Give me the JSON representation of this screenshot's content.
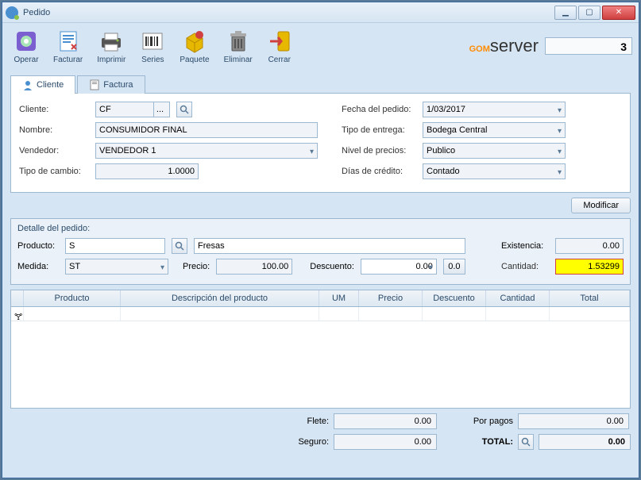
{
  "window": {
    "title": "Pedido"
  },
  "toolbar": {
    "operar": "Operar",
    "facturar": "Facturar",
    "imprimir": "Imprimir",
    "series": "Series",
    "paquete": "Paquete",
    "eliminar": "Eliminar",
    "cerrar": "Cerrar"
  },
  "brand": {
    "number": "3"
  },
  "tabs": {
    "cliente": "Cliente",
    "factura": "Factura"
  },
  "form": {
    "cliente_lbl": "Cliente:",
    "cliente_val": "CF",
    "nombre_lbl": "Nombre:",
    "nombre_val": "CONSUMIDOR FINAL",
    "vendedor_lbl": "Vendedor:",
    "vendedor_val": "VENDEDOR 1",
    "tipo_cambio_lbl": "Tipo de cambio:",
    "tipo_cambio_val": "1.0000",
    "fecha_lbl": "Fecha del pedido:",
    "fecha_val": "1/03/2017",
    "tipo_entrega_lbl": "Tipo de entrega:",
    "tipo_entrega_val": "Bodega Central",
    "nivel_precios_lbl": "Nivel de precios:",
    "nivel_precios_val": "Publico",
    "dias_credito_lbl": "Días de crédito:",
    "dias_credito_val": "Contado"
  },
  "buttons": {
    "modificar": "Modificar"
  },
  "detail": {
    "title": "Detalle del pedido:",
    "producto_lbl": "Producto:",
    "producto_code": "S",
    "producto_desc": "Fresas",
    "existencia_lbl": "Existencia:",
    "existencia_val": "0.00",
    "medida_lbl": "Medida:",
    "medida_val": "ST",
    "precio_lbl": "Precio:",
    "precio_val": "100.00",
    "descuento_lbl": "Descuento:",
    "descuento_val": "0.00",
    "descuento_btn": "0.0",
    "cantidad_lbl": "Cantidad:",
    "cantidad_val": "1.53299"
  },
  "gridh": {
    "producto": "Producto",
    "descripcion": "Descripción del producto",
    "um": "UM",
    "precio": "Precio",
    "descuento": "Descuento",
    "cantidad": "Cantidad",
    "total": "Total"
  },
  "footer": {
    "flete_lbl": "Flete:",
    "flete_val": "0.00",
    "seguro_lbl": "Seguro:",
    "seguro_val": "0.00",
    "porpagos_lbl": "Por pagos",
    "porpagos_val": "0.00",
    "total_lbl": "TOTAL:",
    "total_val": "0.00"
  }
}
